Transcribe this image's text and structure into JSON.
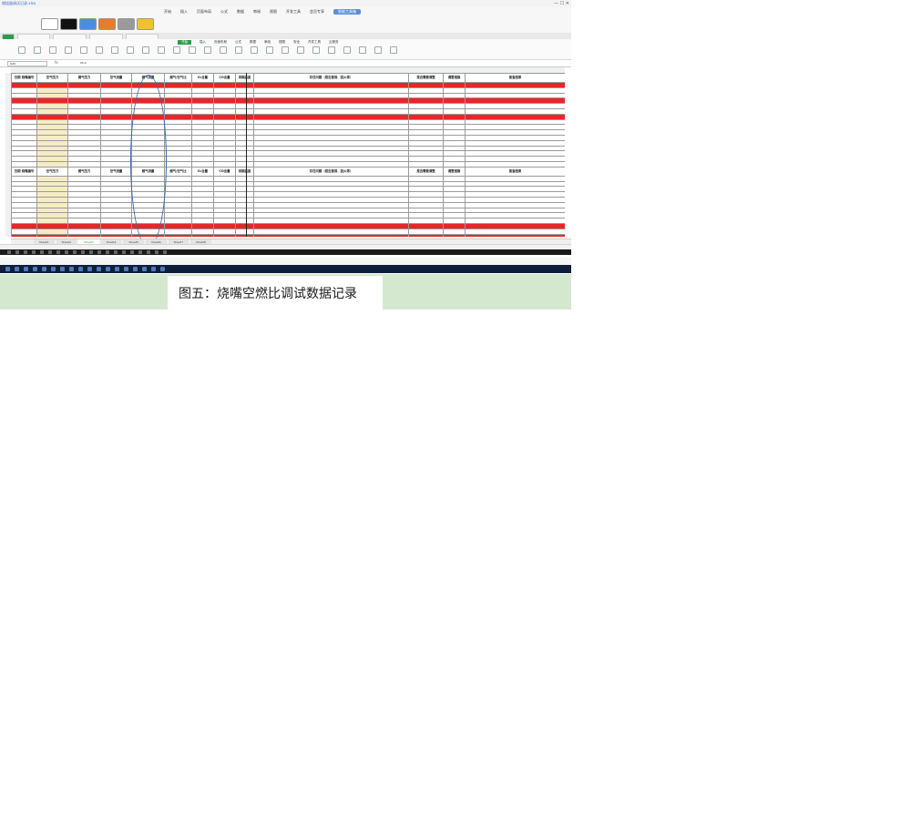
{
  "caption": "图五：烧嘴空燃比调试数据记录",
  "window": {
    "title": "燃烧器调试记录.xlsx"
  },
  "ribbon": {
    "menu": [
      "开始",
      "插入",
      "页面布局",
      "公式",
      "数据",
      "审阅",
      "视图",
      "开发工具",
      "会员专享",
      "智能工具箱"
    ],
    "active_tab": "智能工具箱"
  },
  "toolbar": {
    "menu": [
      "开始",
      "插入",
      "页面布局",
      "公式",
      "数据",
      "审阅",
      "视图",
      "安全",
      "开发工具",
      "云服务"
    ],
    "active_tab": "开始"
  },
  "formula_bar": {
    "name_box": "G20",
    "fx": "fx",
    "value": "95.4"
  },
  "spreadsheet": {
    "headers": [
      "日期\n烧嘴编号",
      "空气压力",
      "燃气压力",
      "空气流量",
      "燃气流量",
      "燃气/空气比",
      "O₂含量",
      "CO含量",
      "排烟温度",
      "存在问题（是否振荡、回火等）",
      "是否需要调整",
      "调整措施",
      "复查结果"
    ],
    "sheet_tabs": [
      "Sheet1",
      "Sheet2",
      "Sheet3",
      "Sheet4",
      "Sheet5",
      "Sheet6",
      "Sheet7",
      "Sheet8"
    ],
    "active_sheet": "Sheet3"
  },
  "colors": {
    "highlight_red": "#e6272a",
    "highlight_yellow": "#f3e93a",
    "accent_green": "#2f9b4a",
    "band_green": "#d4e8d0"
  }
}
